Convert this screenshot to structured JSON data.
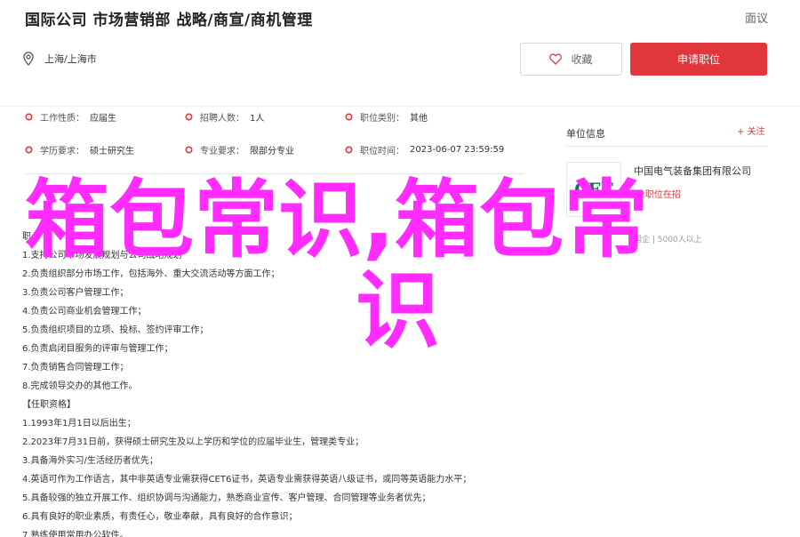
{
  "header": {
    "job_title": "国际公司 市场营销部 战略/商宣/商机管理",
    "report": "面议",
    "location": "上海/上海市",
    "favorite_label": "收藏",
    "apply_label": "申请职位"
  },
  "attributes": [
    {
      "label": "工作性质：",
      "value": "应届生"
    },
    {
      "label": "招聘人数：",
      "value": "1人"
    },
    {
      "label": "职位类别：",
      "value": "其他"
    },
    {
      "label": "学历要求：",
      "value": "硕士研究生"
    },
    {
      "label": "专业要求：",
      "value": "限部分专业"
    },
    {
      "label": "职位时间：",
      "value": "2023-06-07 23:59:59"
    }
  ],
  "description": [
    "职",
    "1.支持公司市场发展规划与公司战略规划",
    "2.负责组织部分市场工作，包括海外、重大交流活动等方面工作；",
    "3.负责公司客户管理工作；",
    "4.负责公司商业机会管理工作；",
    "5.负责组织项目的立项、投标、签约评审工作；",
    "6.负责启闭目服务的评审与管理工作；",
    "7.负责销售合同管理工作；",
    "8.完成领导交办的其他工作。",
    "【任职资格】",
    "1.1993年1月1日以后出生；",
    "2.2023年7月31日前，获得硕士研究生及以上学历和学位的应届毕业生，管理类专业；",
    "3.具备海外实习/生活经历者优先；",
    "4.英语可作为工作语言，其中非英语专业需获得CET6证书，英语专业需获得英语八级证书，或同等英语能力水平；",
    "5.具备较强的独立开展工作、组织协调与沟通能力，熟悉商业宣传、客户管理、合同管理等业务者优先；",
    "6.具有良好的职业素质，有责任心，敬业奉献，具有良好的合作意识；",
    "7.熟练使用常用办公软件。"
  ],
  "sidebar": {
    "unit_info": "单位信息",
    "follow": "+ 关注",
    "logo_text": "CEE",
    "company": "中国电气装备集团有限公司",
    "company_sub": "62职位在招",
    "tags": "国企 | 5000人以上"
  },
  "overlay": {
    "line1": "箱包常识,箱包常",
    "line2": "识"
  },
  "colors": {
    "accent": "#e2363d",
    "overlay": "#ff2bff"
  }
}
